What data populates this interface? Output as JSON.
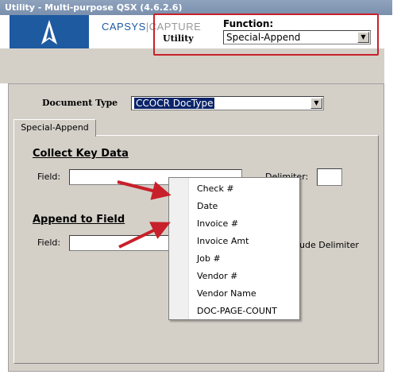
{
  "window": {
    "title": "Utility - Multi-purpose QSX (4.6.2.6)"
  },
  "brand": {
    "part1": "CAPSYS",
    "part2": "CAPTURE"
  },
  "header": {
    "utility_label": "Utility",
    "function_label": "Function:",
    "function_value": "Special-Append"
  },
  "document_type": {
    "label": "Document Type",
    "value": "CCOCR DocType"
  },
  "tabs": [
    {
      "label": "Special-Append"
    }
  ],
  "collect_key_data": {
    "heading": "Collect Key Data",
    "field_label": "Field:",
    "field_value": "",
    "delimiter_label": "Delimiter:",
    "delimiter_value": ""
  },
  "append_to_field": {
    "heading": "Append to Field",
    "field_label": "Field:",
    "field_value": "",
    "include_delimiter_label": "ude Delimiter"
  },
  "dropdown_menu": {
    "items": [
      "Check #",
      "Date",
      "Invoice #",
      "Invoice Amt",
      "Job #",
      "Vendor #",
      "Vendor Name",
      "DOC-PAGE-COUNT"
    ]
  },
  "colors": {
    "annotation_red": "#c8202a",
    "brand_blue": "#1e5aa0",
    "dialog_gray": "#d4d0c8"
  }
}
